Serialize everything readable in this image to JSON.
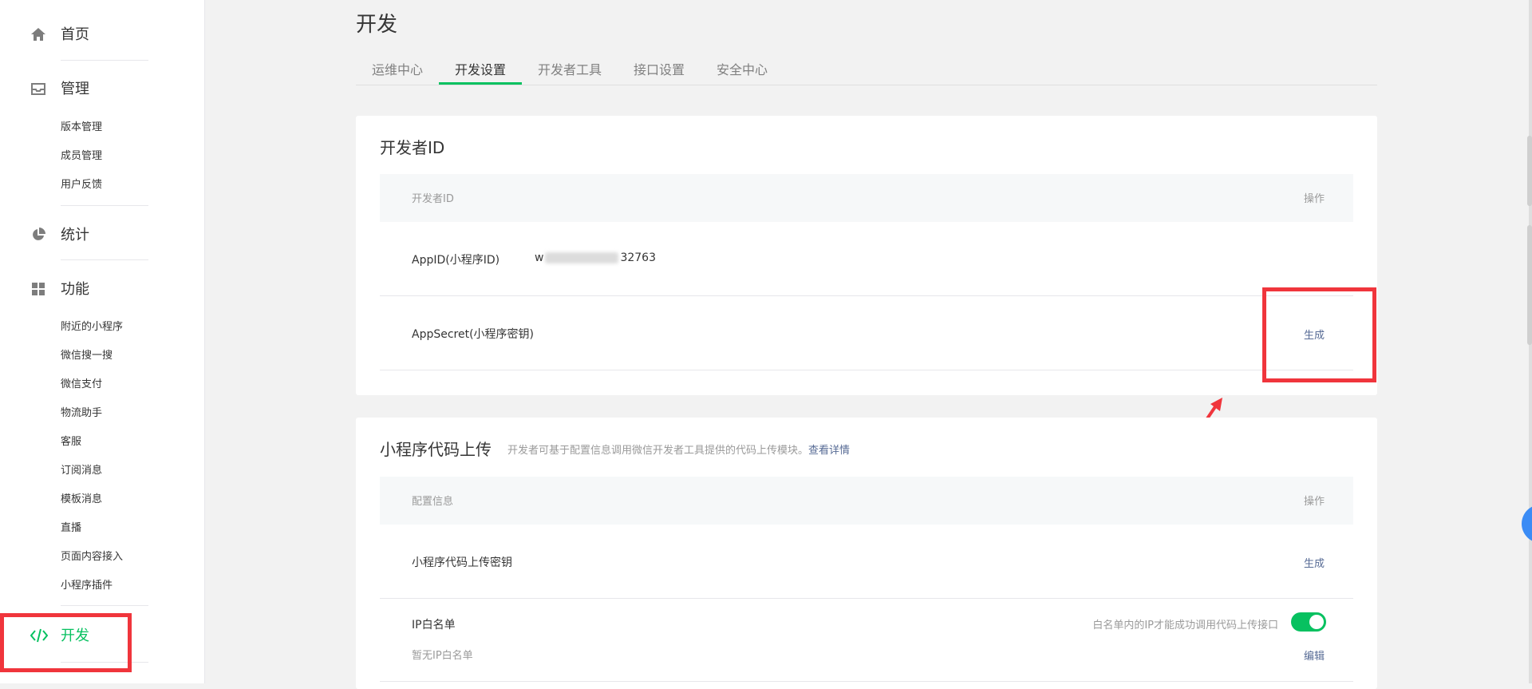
{
  "sidebar": {
    "home": "首页",
    "manage": {
      "label": "管理",
      "items": [
        "版本管理",
        "成员管理",
        "用户反馈"
      ]
    },
    "stats": "统计",
    "features": {
      "label": "功能",
      "items": [
        "附近的小程序",
        "微信搜一搜",
        "微信支付",
        "物流助手",
        "客服",
        "订阅消息",
        "模板消息",
        "直播",
        "页面内容接入",
        "小程序插件"
      ]
    },
    "develop": "开发"
  },
  "page": {
    "title": "开发",
    "tabs": [
      "运维中心",
      "开发设置",
      "开发者工具",
      "接口设置",
      "安全中心"
    ],
    "active_tab": "开发设置"
  },
  "dev_id_card": {
    "title": "开发者ID",
    "header_left": "开发者ID",
    "header_right": "操作",
    "appid_label": "AppID(小程序ID)",
    "appid_prefix": "w",
    "appid_suffix": "32763",
    "secret_label": "AppSecret(小程序密钥)",
    "secret_action": "生成"
  },
  "upload_card": {
    "title": "小程序代码上传",
    "desc": "开发者可基于配置信息调用微信开发者工具提供的代码上传模块。",
    "desc_link": "查看详情",
    "header_left": "配置信息",
    "header_right": "操作",
    "key_label": "小程序代码上传密钥",
    "key_action": "生成",
    "ip_label": "IP白名单",
    "ip_empty": "暂无IP白名单",
    "ip_hint": "白名单内的IP才能成功调用代码上传接口",
    "ip_toggle_on": true,
    "ip_action": "编辑"
  },
  "colors": {
    "accent": "#07c160",
    "link": "#576b95",
    "highlight": "#f0353c"
  }
}
